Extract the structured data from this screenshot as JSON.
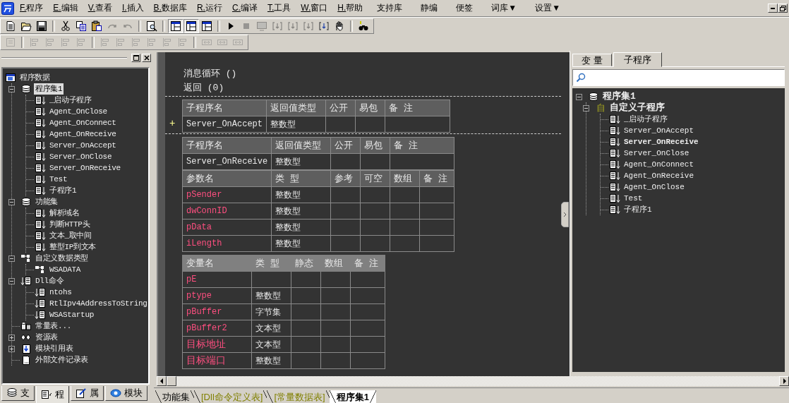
{
  "menu": {
    "items": [
      {
        "key": "F.",
        "label": "程序"
      },
      {
        "key": "E.",
        "label": "编辑"
      },
      {
        "key": "V.",
        "label": "查看"
      },
      {
        "key": "I.",
        "label": "插入"
      },
      {
        "key": "B.",
        "label": "数据库"
      },
      {
        "key": "R.",
        "label": "运行"
      },
      {
        "key": "C.",
        "label": "编译"
      },
      {
        "key": "T.",
        "label": "工具"
      },
      {
        "key": "W.",
        "label": "窗口"
      },
      {
        "key": "H.",
        "label": "帮助"
      },
      {
        "label": "支持库"
      },
      {
        "label": "静编"
      },
      {
        "label": "便签"
      },
      {
        "label": "词库▼"
      },
      {
        "label": "设置▼"
      }
    ]
  },
  "toolbars": [
    [
      {
        "kind": "new",
        "pressed": false,
        "disabled": false
      },
      {
        "kind": "open",
        "pressed": false,
        "disabled": false
      },
      {
        "kind": "save",
        "pressed": false,
        "disabled": false
      },
      {
        "kind": "separator"
      },
      {
        "kind": "cut",
        "pressed": false,
        "disabled": false
      },
      {
        "kind": "copy",
        "pressed": false,
        "disabled": false
      },
      {
        "kind": "paste",
        "pressed": false,
        "disabled": false
      },
      {
        "kind": "redo",
        "pressed": false,
        "disabled": true
      },
      {
        "kind": "undo",
        "pressed": false,
        "disabled": true
      },
      {
        "kind": "separator"
      },
      {
        "kind": "preview",
        "pressed": false,
        "disabled": false
      },
      {
        "kind": "separator"
      },
      {
        "kind": "layout",
        "pressed": true,
        "disabled": false
      },
      {
        "kind": "layout",
        "pressed": true,
        "disabled": false
      },
      {
        "kind": "layout",
        "pressed": false,
        "disabled": false
      },
      {
        "kind": "separator"
      },
      {
        "kind": "run",
        "pressed": false,
        "disabled": false
      },
      {
        "kind": "stop",
        "pressed": false,
        "disabled": true
      },
      {
        "kind": "compile",
        "pressed": false,
        "disabled": true
      },
      {
        "kind": "step",
        "pressed": false,
        "disabled": true
      },
      {
        "kind": "step",
        "pressed": false,
        "disabled": true
      },
      {
        "kind": "step",
        "pressed": false,
        "disabled": true
      },
      {
        "kind": "step",
        "pressed": false,
        "disabled": false
      },
      {
        "kind": "hand",
        "pressed": false,
        "disabled": false
      },
      {
        "kind": "separator"
      },
      {
        "kind": "find",
        "pressed": false,
        "disabled": false
      }
    ],
    [
      {
        "kind": "grid",
        "pressed": false,
        "disabled": true
      },
      {
        "kind": "separator"
      },
      {
        "kind": "align",
        "pressed": false,
        "disabled": true
      },
      {
        "kind": "align",
        "pressed": false,
        "disabled": true
      },
      {
        "kind": "align",
        "pressed": false,
        "disabled": true
      },
      {
        "kind": "align",
        "pressed": false,
        "disabled": true
      },
      {
        "kind": "separator"
      },
      {
        "kind": "align",
        "pressed": false,
        "disabled": true
      },
      {
        "kind": "align",
        "pressed": false,
        "disabled": true
      },
      {
        "kind": "align",
        "pressed": false,
        "disabled": true
      },
      {
        "kind": "align",
        "pressed": false,
        "disabled": true
      },
      {
        "kind": "align",
        "pressed": false,
        "disabled": true
      },
      {
        "kind": "align",
        "pressed": false,
        "disabled": true
      },
      {
        "kind": "separator"
      },
      {
        "kind": "size",
        "pressed": false,
        "disabled": true
      },
      {
        "kind": "size",
        "pressed": false,
        "disabled": true
      },
      {
        "kind": "size",
        "pressed": false,
        "disabled": true
      }
    ]
  ],
  "left_panel": {
    "tree": {
      "label": "程序数据",
      "kind": "root",
      "selected": false,
      "children": [
        {
          "label": "程序集1",
          "kind": "set",
          "selected": true,
          "expanded": true,
          "children": [
            {
              "label": "_启动子程序",
              "kind": "sub",
              "selected": false
            },
            {
              "label": "Agent_OnClose",
              "kind": "sub",
              "selected": false
            },
            {
              "label": "Agent_OnConnect",
              "kind": "sub",
              "selected": false
            },
            {
              "label": "Agent_OnReceive",
              "kind": "sub",
              "selected": false
            },
            {
              "label": "Server_OnAccept",
              "kind": "sub",
              "selected": false
            },
            {
              "label": "Server_OnClose",
              "kind": "sub",
              "selected": false
            },
            {
              "label": "Server_OnReceive",
              "kind": "sub",
              "selected": false
            },
            {
              "label": "Test",
              "kind": "sub",
              "selected": false
            },
            {
              "label": "子程序1",
              "kind": "sub",
              "selected": false
            }
          ]
        },
        {
          "label": "功能集",
          "kind": "set",
          "selected": false,
          "expanded": true,
          "children": [
            {
              "label": "解析域名",
              "kind": "sub",
              "selected": false
            },
            {
              "label": "判断HTTP头",
              "kind": "sub",
              "selected": false
            },
            {
              "label": "文本_取中间",
              "kind": "sub",
              "selected": false
            },
            {
              "label": "整型IP到文本",
              "kind": "sub",
              "selected": false
            }
          ]
        },
        {
          "label": "自定义数据类型",
          "kind": "type",
          "selected": false,
          "expanded": true,
          "children": [
            {
              "label": "WSADATA",
              "kind": "type",
              "selected": false
            }
          ]
        },
        {
          "label": "Dll命令",
          "kind": "dll",
          "selected": false,
          "expanded": true,
          "children": [
            {
              "label": "ntohs",
              "kind": "dll",
              "selected": false
            },
            {
              "label": "RtlIpv4AddressToString",
              "kind": "dll",
              "selected": false
            },
            {
              "label": "WSAStartup",
              "kind": "dll",
              "selected": false
            }
          ]
        },
        {
          "label": "常量表...",
          "kind": "const",
          "selected": false
        },
        {
          "label": "资源表",
          "kind": "res",
          "selected": false,
          "expanded": false
        },
        {
          "label": "模块引用表",
          "kind": "module",
          "selected": false,
          "expanded": false
        },
        {
          "label": "外部文件记录表",
          "kind": "file",
          "selected": false
        }
      ]
    },
    "tabs": [
      {
        "label": "支",
        "kind": "support",
        "selected": false
      },
      {
        "label": "程",
        "kind": "program",
        "selected": true
      },
      {
        "label": "属",
        "kind": "property",
        "selected": false
      },
      {
        "label": "模块",
        "kind": "module",
        "selected": false
      }
    ]
  },
  "editor": {
    "lines": [
      "消息循环 ()",
      "返回 (0)"
    ],
    "subroutines": [
      {
        "marker": "+",
        "header": [
          "子程序名",
          "返回值类型",
          "公开",
          "易包",
          "备 注"
        ],
        "row": [
          "Server_OnAccept",
          "整数型"
        ]
      },
      {
        "header": [
          "子程序名",
          "返回值类型",
          "公开",
          "易包",
          "备 注"
        ],
        "row": [
          "Server_OnReceive",
          "整数型"
        ],
        "params": {
          "header": [
            "参数名",
            "类 型",
            "参考",
            "可空",
            "数组",
            "备 注"
          ],
          "rows": [
            [
              "pSender",
              "整数型"
            ],
            [
              "dwConnID",
              "整数型"
            ],
            [
              "pData",
              "整数型"
            ],
            [
              "iLength",
              "整数型"
            ]
          ]
        }
      }
    ],
    "locals": {
      "header": [
        "变量名",
        "类 型",
        "静态",
        "数组",
        "备 注"
      ],
      "rows": [
        [
          "pE"
        ],
        [
          "ptype",
          "整数型"
        ],
        [
          "pBuffer",
          "字节集"
        ],
        [
          "pBuffer2",
          "文本型"
        ],
        [
          "目标地址",
          "文本型"
        ],
        [
          "目标端口",
          "整数型"
        ]
      ]
    }
  },
  "right_panel": {
    "tabs": [
      {
        "label": "变 量",
        "selected": false
      },
      {
        "label": "子程序",
        "selected": true
      }
    ],
    "tree": {
      "label": "程序集1",
      "kind": "set",
      "expanded": true,
      "children": [
        {
          "label": "自定义子程序",
          "kind": "group",
          "icon_text": "自",
          "expanded": true,
          "children": [
            {
              "label": "_启动子程序",
              "kind": "sub",
              "selected": false
            },
            {
              "label": "Server_OnAccept",
              "kind": "sub",
              "selected": false
            },
            {
              "label": "Server_OnReceive",
              "kind": "sub",
              "selected": true
            },
            {
              "label": "Server_OnClose",
              "kind": "sub",
              "selected": false
            },
            {
              "label": "Agent_OnConnect",
              "kind": "sub",
              "selected": false
            },
            {
              "label": "Agent_OnReceive",
              "kind": "sub",
              "selected": false
            },
            {
              "label": "Agent_OnClose",
              "kind": "sub",
              "selected": false
            },
            {
              "label": "Test",
              "kind": "sub",
              "selected": false
            },
            {
              "label": "子程序1",
              "kind": "sub",
              "selected": false
            }
          ]
        }
      ]
    }
  },
  "document_tabs": [
    {
      "label": "功能集",
      "kind": "code",
      "selected": false
    },
    {
      "label": "[Dll命令定义表]",
      "kind": "table",
      "selected": false
    },
    {
      "label": "[常量数据表]",
      "kind": "table",
      "selected": false
    },
    {
      "label": "程序集1",
      "kind": "code",
      "selected": true
    }
  ]
}
